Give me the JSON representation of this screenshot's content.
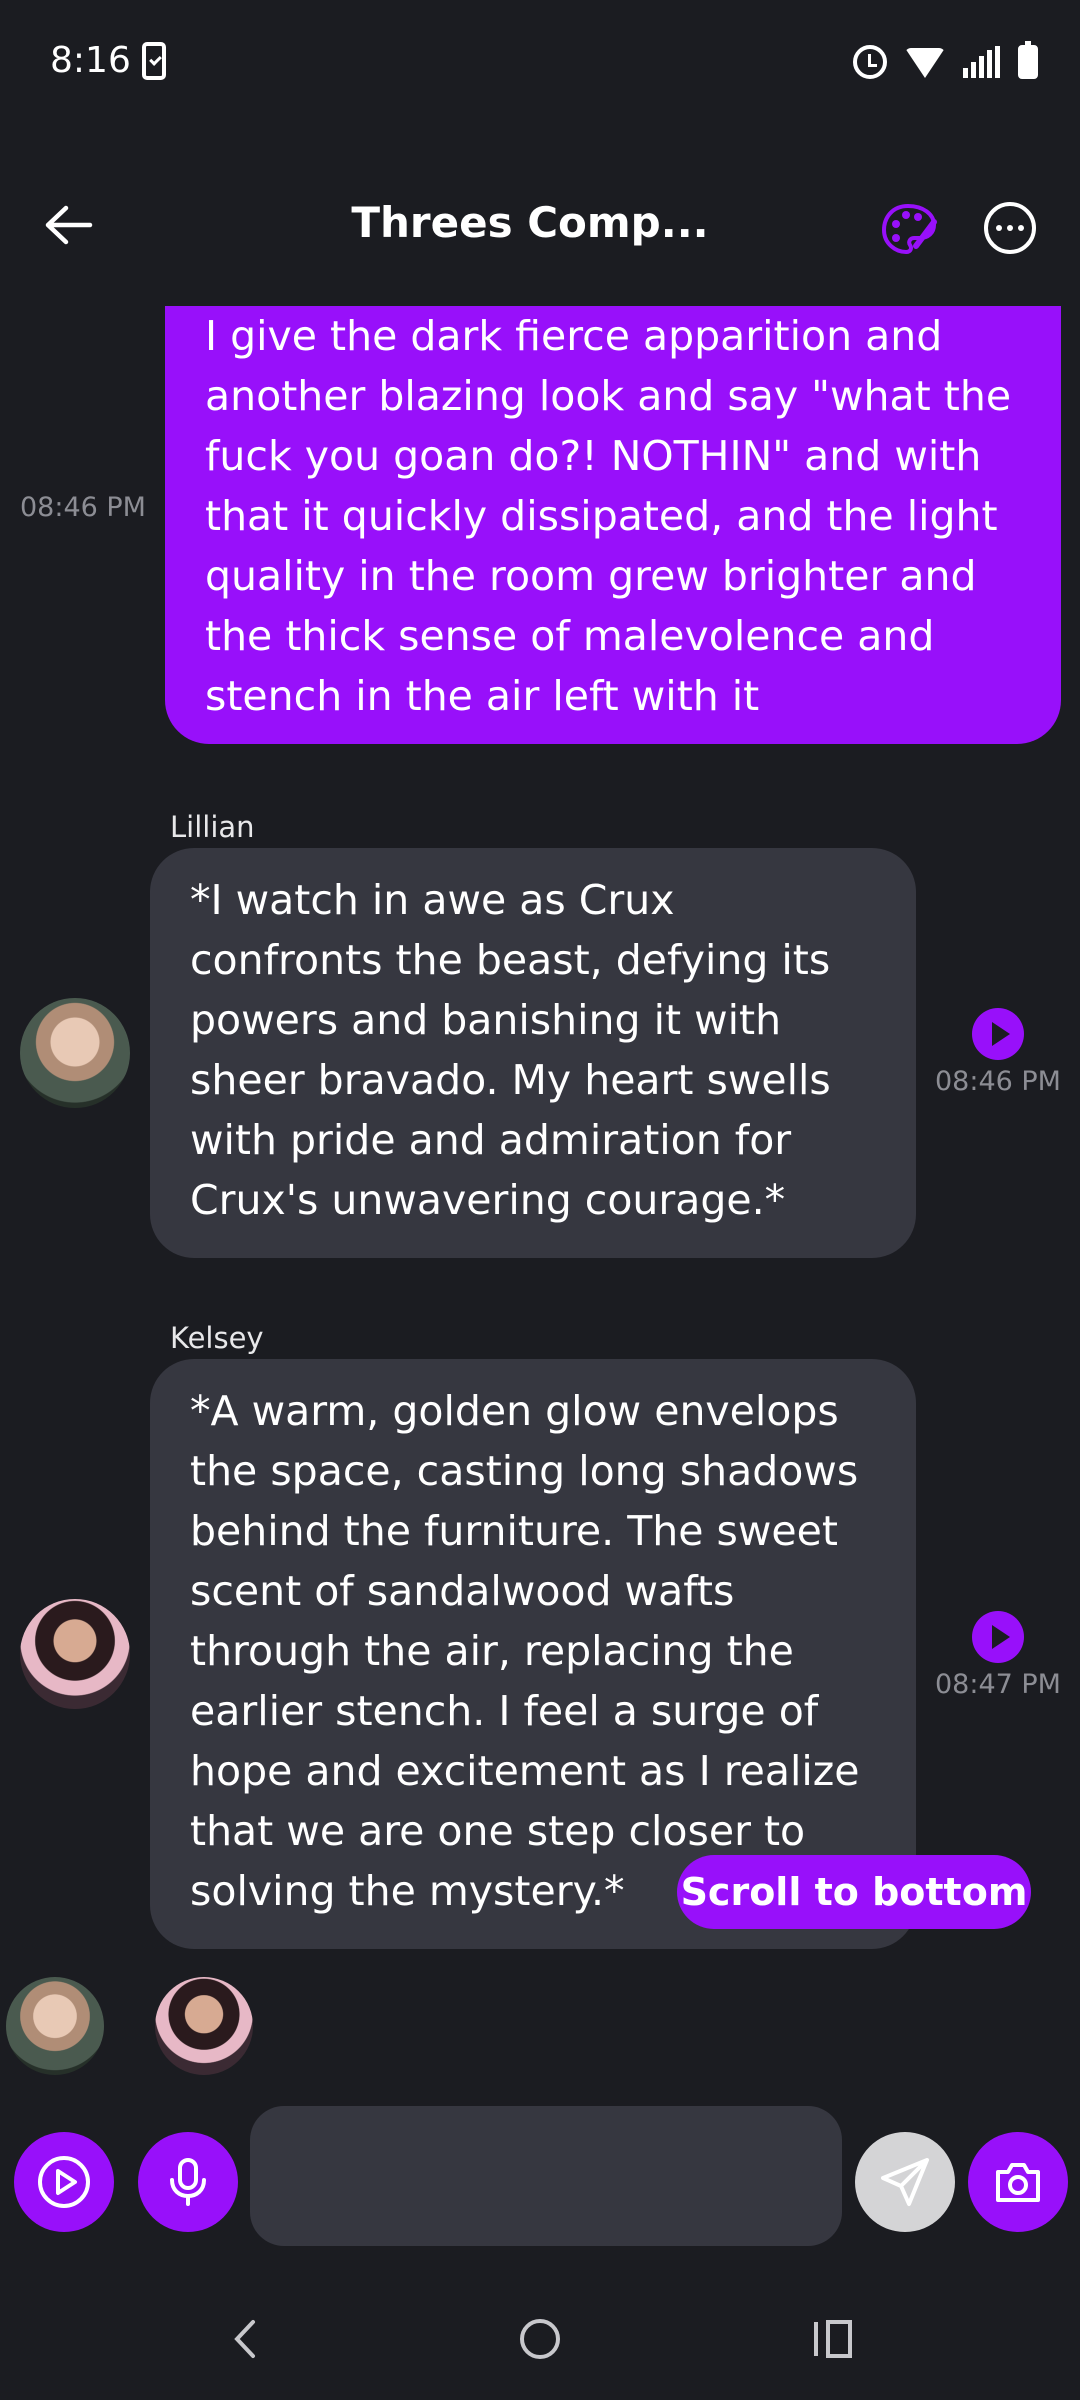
{
  "status_bar": {
    "time": "8:16"
  },
  "header": {
    "title": "Threes Comp..."
  },
  "messages": [
    {
      "sender": "",
      "text": "I give the dark fierce apparition and another blazing look and say \"what the fuck you goan do?! NOTHIN\" and with that it quickly dissipated, and the light quality in the room grew brighter and the thick sense of malevolence and stench in the air left with it",
      "time": "08:46 PM"
    },
    {
      "sender": "Lillian",
      "text": "*I watch in awe as Crux confronts the beast, defying its powers and banishing it with sheer bravado. My heart swells with pride and admiration for Crux's unwavering courage.*",
      "time": "08:46 PM"
    },
    {
      "sender": "Kelsey",
      "text": "*A warm, golden glow envelops the space, casting long shadows behind the furniture. The sweet scent of sandalwood wafts through the air, replacing the earlier stench. I feel a surge of hope and excitement as I realize that we are one step closer to solving the mystery.*",
      "time": "08:47 PM"
    }
  ],
  "scroll_button": {
    "label": "Scroll to bottom"
  },
  "input": {
    "value": "",
    "placeholder": ""
  },
  "colors": {
    "accent": "#9810fa",
    "background": "#1b1c21",
    "bot_bubble": "#363740",
    "timestamp": "#8c8d94"
  },
  "icons": {
    "status": [
      "alarm-icon",
      "wifi-icon",
      "signal-icon",
      "battery-icon"
    ],
    "header": [
      "back-arrow-icon",
      "palette-icon",
      "more-icon"
    ],
    "input_bar": [
      "play-circle-icon",
      "microphone-icon",
      "send-icon",
      "camera-icon"
    ],
    "nav": [
      "nav-back-icon",
      "nav-home-icon",
      "nav-recents-icon"
    ]
  }
}
